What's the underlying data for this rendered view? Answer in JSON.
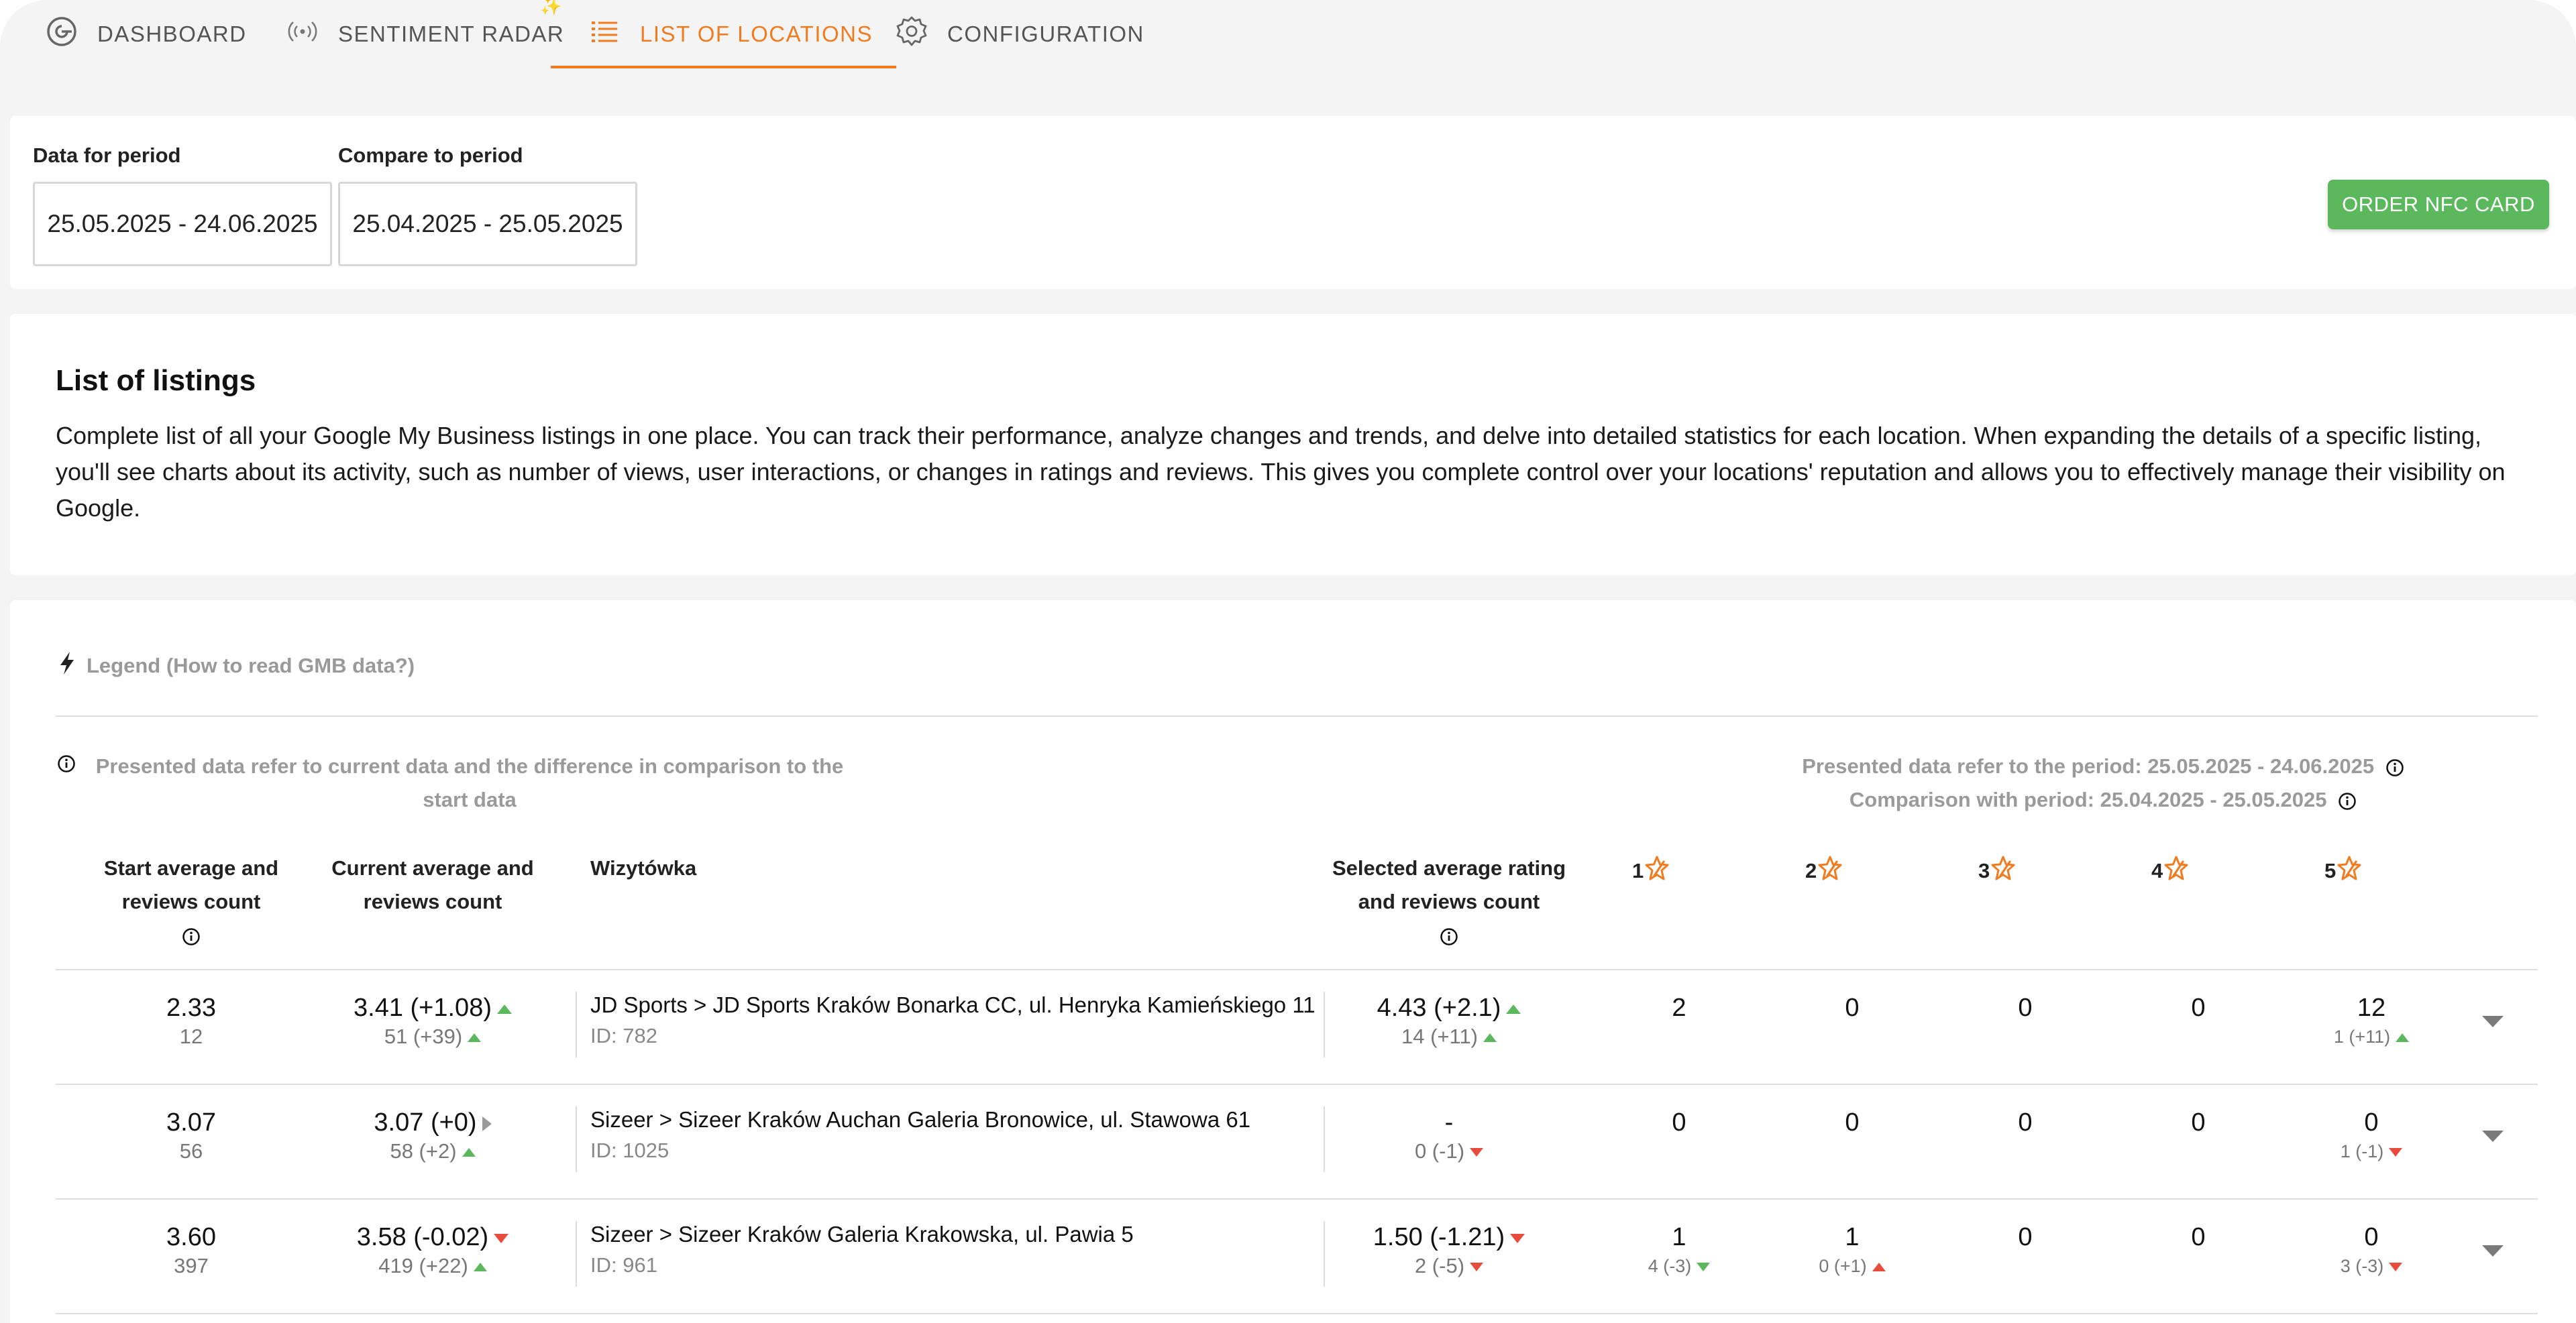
{
  "tabs": [
    {
      "label": "DASHBOARD",
      "icon": "google-g-icon"
    },
    {
      "label": "SENTIMENT RADAR",
      "icon": "radar-icon"
    },
    {
      "label": "LIST OF LOCATIONS",
      "icon": "list-icon",
      "active": true
    },
    {
      "label": "CONFIGURATION",
      "icon": "gear-icon"
    }
  ],
  "filters": {
    "data_period_label": "Data for period",
    "data_period_value": "25.05.2025 - 24.06.2025",
    "compare_period_label": "Compare to period",
    "compare_period_value": "25.04.2025 - 25.05.2025",
    "order_button": "ORDER NFC CARD"
  },
  "intro": {
    "title": "List of listings",
    "description": "Complete list of all your Google My Business listings in one place. You can track their performance, analyze changes and trends, and delve into detailed statistics for each location. When expanding the details of a specific listing, you'll see charts about its activity, such as number of views, user interactions, or changes in ratings and reviews. This gives you complete control over your locations' reputation and allows you to effectively manage their visibility on Google."
  },
  "table": {
    "legend_link": "Legend (How to read GMB data?)",
    "note_left": "Presented data refer to current data and the difference in comparison to the start data",
    "note_right_1": "Presented data refer to the period: 25.05.2025 - 24.06.2025",
    "note_right_2": "Comparison with period: 25.04.2025 - 25.05.2025",
    "headers": {
      "start": "Start average and reviews count",
      "current": "Current average and reviews count",
      "listing": "Wizytówka",
      "selected": "Selected average rating and reviews count",
      "stars": [
        "1",
        "2",
        "3",
        "4",
        "5"
      ]
    },
    "colors": {
      "accent": "#ef7c21",
      "up": "#5cb85c",
      "down": "#e74c3c",
      "neutral": "#999999"
    },
    "rows": [
      {
        "start_avg": "2.33",
        "start_count": "12",
        "cur_avg": "3.41 (+1.08)",
        "cur_avg_trend": "up",
        "cur_count": "51 (+39)",
        "cur_count_trend": "up",
        "name": "JD Sports > JD Sports Kraków Bonarka CC, ul. Henryka Kamieńskiego 11",
        "id": "ID: 782",
        "sel_avg": "4.43 (+2.1)",
        "sel_avg_trend": "up",
        "sel_count": "14 (+11)",
        "sel_count_trend": "up",
        "stars": [
          {
            "value": "2",
            "sub": "",
            "trend": ""
          },
          {
            "value": "0",
            "sub": "",
            "trend": ""
          },
          {
            "value": "0",
            "sub": "",
            "trend": ""
          },
          {
            "value": "0",
            "sub": "",
            "trend": ""
          },
          {
            "value": "12",
            "sub": "1 (+11)",
            "trend": "up"
          }
        ]
      },
      {
        "start_avg": "3.07",
        "start_count": "56",
        "cur_avg": "3.07 (+0)",
        "cur_avg_trend": "flat",
        "cur_count": "58 (+2)",
        "cur_count_trend": "up",
        "name": "Sizeer > Sizeer Kraków Auchan Galeria Bronowice, ul. Stawowa 61",
        "id": "ID: 1025",
        "sel_avg": "-",
        "sel_avg_trend": "",
        "sel_count": "0 (-1)",
        "sel_count_trend": "down",
        "stars": [
          {
            "value": "0",
            "sub": "",
            "trend": ""
          },
          {
            "value": "0",
            "sub": "",
            "trend": ""
          },
          {
            "value": "0",
            "sub": "",
            "trend": ""
          },
          {
            "value": "0",
            "sub": "",
            "trend": ""
          },
          {
            "value": "0",
            "sub": "1 (-1)",
            "trend": "down"
          }
        ]
      },
      {
        "start_avg": "3.60",
        "start_count": "397",
        "cur_avg": "3.58 (-0.02)",
        "cur_avg_trend": "down",
        "cur_count": "419 (+22)",
        "cur_count_trend": "up",
        "name": "Sizeer > Sizeer Kraków Galeria Krakowska, ul. Pawia 5",
        "id": "ID: 961",
        "sel_avg": "1.50 (-1.21)",
        "sel_avg_trend": "down",
        "sel_count": "2 (-5)",
        "sel_count_trend": "down",
        "stars": [
          {
            "value": "1",
            "sub": "4 (-3)",
            "trend": "down-green"
          },
          {
            "value": "1",
            "sub": "0 (+1)",
            "trend": "up-red"
          },
          {
            "value": "0",
            "sub": "",
            "trend": ""
          },
          {
            "value": "0",
            "sub": "",
            "trend": ""
          },
          {
            "value": "0",
            "sub": "3 (-3)",
            "trend": "down"
          }
        ]
      }
    ]
  }
}
